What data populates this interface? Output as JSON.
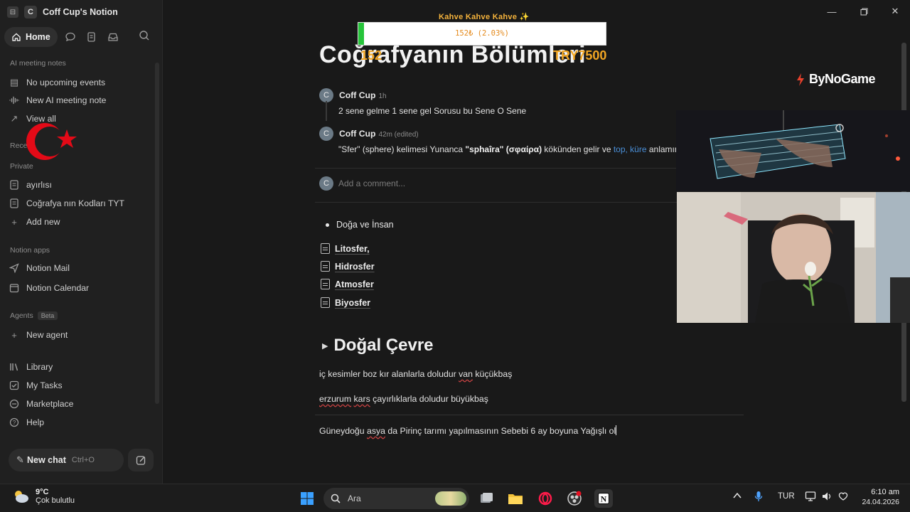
{
  "window": {
    "workspace_name": "Coff Cup's Notion",
    "workspace_initial": "C"
  },
  "sidebar": {
    "home_label": "Home",
    "ai_notes_label": "AI meeting notes",
    "ai_items": [
      {
        "label": "No upcoming events",
        "icon": "calendar-icon"
      },
      {
        "label": "New AI meeting note",
        "icon": "waveform-icon"
      },
      {
        "label": "View all",
        "icon": "arrow-up-right-icon"
      }
    ],
    "recents_label": "Rece",
    "private_label": "Private",
    "private_items": [
      {
        "label": "ayırlısı",
        "icon": "page-icon"
      },
      {
        "label": "Coğrafya nın Kodları TYT",
        "icon": "page-icon"
      },
      {
        "label": "Add new",
        "icon": "plus-icon"
      }
    ],
    "apps_label": "Notion apps",
    "apps_items": [
      {
        "label": "Notion Mail",
        "icon": "mail-send-icon"
      },
      {
        "label": "Notion Calendar",
        "icon": "calendar-icon"
      }
    ],
    "agents_label": "Agents",
    "agents_badge": "Beta",
    "agents_items": [
      {
        "label": "New agent",
        "icon": "plus-icon"
      }
    ],
    "bottom_items": [
      {
        "label": "Library",
        "icon": "library-icon"
      },
      {
        "label": "My Tasks",
        "icon": "checkbox-icon"
      },
      {
        "label": "Marketplace",
        "icon": "marketplace-icon"
      },
      {
        "label": "Help",
        "icon": "help-icon"
      }
    ],
    "new_chat_label": "New chat",
    "new_chat_shortcut": "Ctrl+O"
  },
  "page": {
    "title": "Coğrafyanın Bölümleri",
    "comments": [
      {
        "initial": "C",
        "author": "Coff Cup",
        "time": "1h",
        "text": "2 sene gelme 1 sene gel Sorusu bu Sene O Sene"
      },
      {
        "initial": "C",
        "author": "Coff Cup",
        "time": "42m (edited)",
        "text_a": "\"Sfer\" (sphere) kelimesi Yunanca ",
        "text_b": "\"sphaîra\" (σφαίρα)",
        "text_c": " kökünden gelir ve ",
        "text_link": "top, küre",
        "text_d": " anlamına ge"
      }
    ],
    "add_comment_placeholder": "Add a comment...",
    "add_comment_initial": "C",
    "bullet": "Doğa ve İnsan",
    "sub_pages": [
      "Litosfer,",
      "Hidrosfer",
      "Atmosfer",
      "Biyosfer"
    ],
    "toggle_heading": "Doğal Çevre",
    "para1": {
      "a": "iç kesimler boz kır alanlarla doludur ",
      "b": "van",
      "c": " küçükbaş"
    },
    "para2": {
      "a": "erzurum",
      "b": " ",
      "c": "kars",
      "d": " çayırlıklarla doludur büyükbaş"
    },
    "para3": {
      "a": "Güneydoğu ",
      "b": "asya",
      "c": " da Pirinç tarımı yapılmasının Sebebi 6 ay boyuna Yağışlı ol"
    }
  },
  "overlay": {
    "goal_title": "Kahve Kahve Kahve ✨",
    "goal_progress_text": "152₺ (2.03%)",
    "goal_fraction": 0.0203,
    "goal_left_num": "152",
    "goal_right_num": "TRY7500",
    "sponsor": "ByNoGame"
  },
  "taskbar": {
    "temp": "9°C",
    "weather": "Çok bulutlu",
    "search": "Ara",
    "lang": "TUR",
    "time": "6:10 am",
    "date": "24.04.2026"
  },
  "colors": {
    "accent_link": "#4a8fd8",
    "goal_text": "#f4b23c",
    "goal_fill": "#26c43a",
    "flag_red": "#e30a17"
  }
}
